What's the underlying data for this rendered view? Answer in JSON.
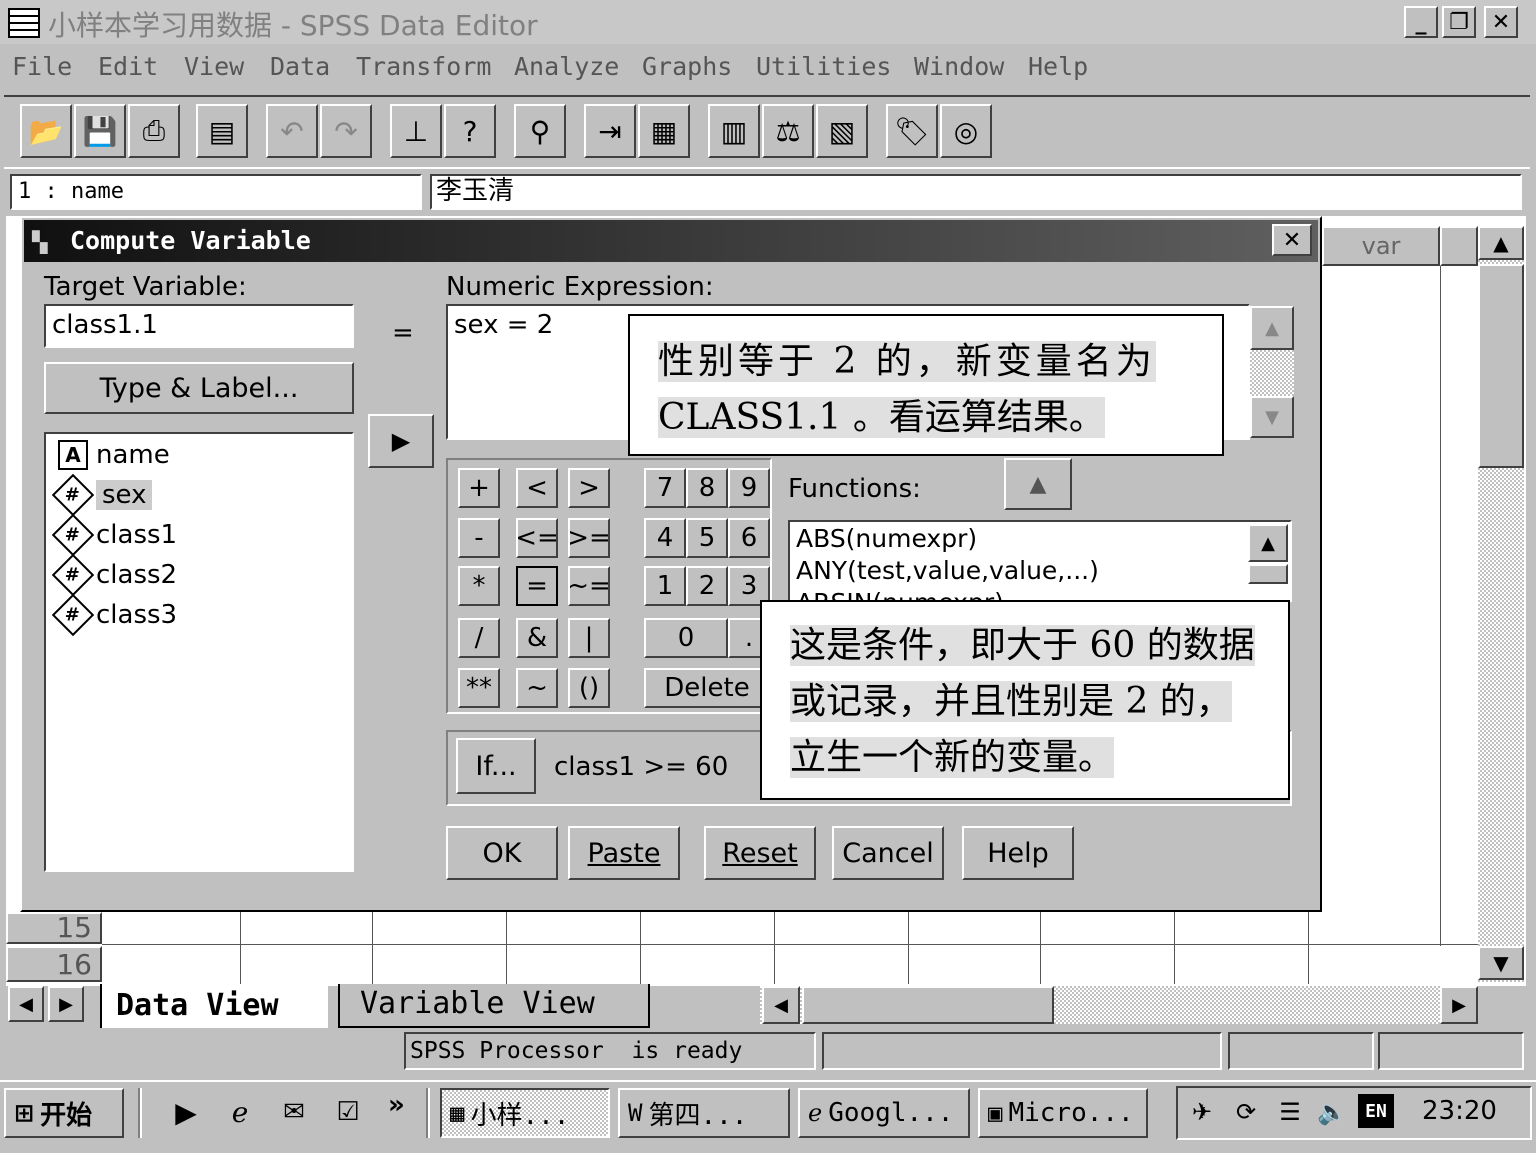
{
  "window": {
    "title": "小样本学习用数据 - SPSS Data Editor",
    "min_icon": "minimize-icon",
    "max_icon": "maximize-icon",
    "close_icon": "close-icon"
  },
  "menu": [
    "File",
    "Edit",
    "View",
    "Data",
    "Transform",
    "Analyze",
    "Graphs",
    "Utilities",
    "Window",
    "Help"
  ],
  "cellbar": {
    "ref": "1 : name",
    "value": "李玉清"
  },
  "grid": {
    "col_header": "var",
    "row_labels": [
      "15",
      "16"
    ]
  },
  "dialog": {
    "title": "Compute Variable",
    "target_label": "Target Variable:",
    "target_value": "class1.1",
    "equals": "=",
    "type_label_button": "Type & Label...",
    "variables": [
      {
        "name": "name",
        "type": "string"
      },
      {
        "name": "sex",
        "type": "numeric"
      },
      {
        "name": "class1",
        "type": "numeric"
      },
      {
        "name": "class2",
        "type": "numeric"
      },
      {
        "name": "class3",
        "type": "numeric"
      }
    ],
    "expr_label": "Numeric Expression:",
    "expr_value": "sex = 2",
    "keypad": {
      "ops": [
        "+",
        "<",
        ">",
        "-",
        "<=",
        ">=",
        "*",
        "=",
        "~=",
        "/",
        "&",
        "|",
        "**",
        "~",
        "()"
      ],
      "digits": [
        "7",
        "8",
        "9",
        "4",
        "5",
        "6",
        "1",
        "2",
        "3",
        "0",
        "."
      ],
      "delete": "Delete"
    },
    "functions_label": "Functions:",
    "functions": [
      "ABS(numexpr)",
      "ANY(test,value,value,...)",
      "ARSIN(numexpr)"
    ],
    "if_button": "If...",
    "if_condition": "class1 >= 60",
    "buttons": {
      "ok": "OK",
      "paste": "Paste",
      "reset": "Reset",
      "cancel": "Cancel",
      "help": "Help"
    }
  },
  "notes": {
    "note1_line1": "性别等于 2 的，新变量名为",
    "note1_line2": "CLASS1.1 。看运算结果。",
    "note2_line1": "这是条件，即大于 60 的数据",
    "note2_line2": "或记录，并且性别是 2 的，",
    "note2_line3": "立生一个新的变量。"
  },
  "tabs": {
    "data_view": "Data View",
    "variable_view": "Variable View"
  },
  "status": {
    "text": "SPSS Processor  is ready"
  },
  "taskbar": {
    "start": "开始",
    "quicklaunch_more": "»",
    "tasks": [
      "小样...",
      "第四...",
      "Googl...",
      "Micro..."
    ],
    "tray_lang": "EN",
    "clock": "23:20"
  }
}
